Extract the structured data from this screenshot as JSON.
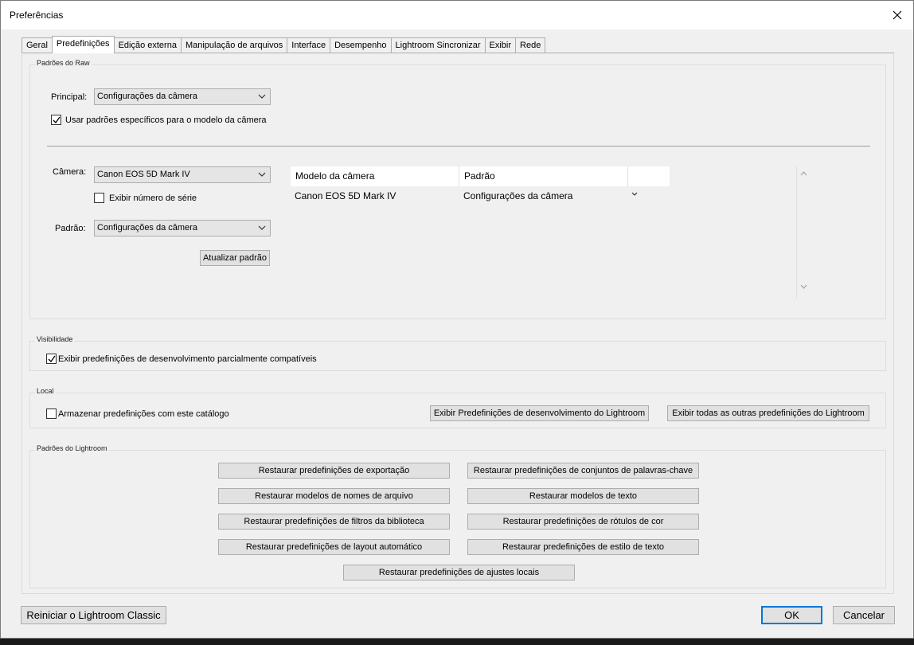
{
  "window": {
    "title": "Preferências"
  },
  "tabs": [
    "Geral",
    "Predefinições",
    "Edição externa",
    "Manipulação de arquivos",
    "Interface",
    "Desempenho",
    "Lightroom Sincronizar",
    "Exibir",
    "Rede"
  ],
  "active_tab": "Predefinições",
  "raw_defaults": {
    "title": "Padrões do Raw",
    "principal_label": "Principal:",
    "principal_value": "Configurações da câmera",
    "camera_specific_label": "Usar padrões específicos para o modelo da câmera",
    "camera_specific_checked": true,
    "camera_label": "Câmera:",
    "camera_value": "Canon EOS 5D Mark IV",
    "show_serial_label": "Exibir número de série",
    "show_serial_checked": false,
    "padrao_label": "Padrão:",
    "padrao_value": "Configurações da câmera",
    "update_button": "Atualizar padrão",
    "table": {
      "headers": [
        "Modelo da câmera",
        "Padrão"
      ],
      "rows": [
        {
          "model": "Canon EOS 5D Mark IV",
          "default": "Configurações da câmera"
        }
      ]
    }
  },
  "visibility": {
    "title": "Visibilidade",
    "partial_label": "Exibir predefinições de desenvolvimento parcialmente compatíveis",
    "partial_checked": true
  },
  "local": {
    "title": "Local",
    "store_label": "Armazenar predefinições com este catálogo",
    "store_checked": false,
    "show_dev_button": "Exibir Predefinições de desenvolvimento do Lightroom",
    "show_other_button": "Exibir todas as outras predefinições do Lightroom"
  },
  "lightroom_defaults": {
    "title": "Padrões do Lightroom",
    "buttons": {
      "export": "Restaurar predefinições de exportação",
      "keywords": "Restaurar predefinições de conjuntos de palavras-chave",
      "filenames": "Restaurar modelos de nomes de arquivo",
      "text_templates": "Restaurar modelos de texto",
      "library_filters": "Restaurar predefinições de filtros da biblioteca",
      "color_labels": "Restaurar predefinições de rótulos de cor",
      "auto_layout": "Restaurar predefinições de layout automático",
      "text_style": "Restaurar predefinições de estilo de texto",
      "local_adjustments": "Restaurar predefinições de ajustes locais"
    }
  },
  "footer": {
    "restart_button": "Reiniciar o Lightroom Classic",
    "ok_button": "OK",
    "cancel_button": "Cancelar"
  },
  "colors": {
    "accent": "#0078d7",
    "dialog_bg": "#f0f0f0",
    "background": "#2b2b2b"
  }
}
